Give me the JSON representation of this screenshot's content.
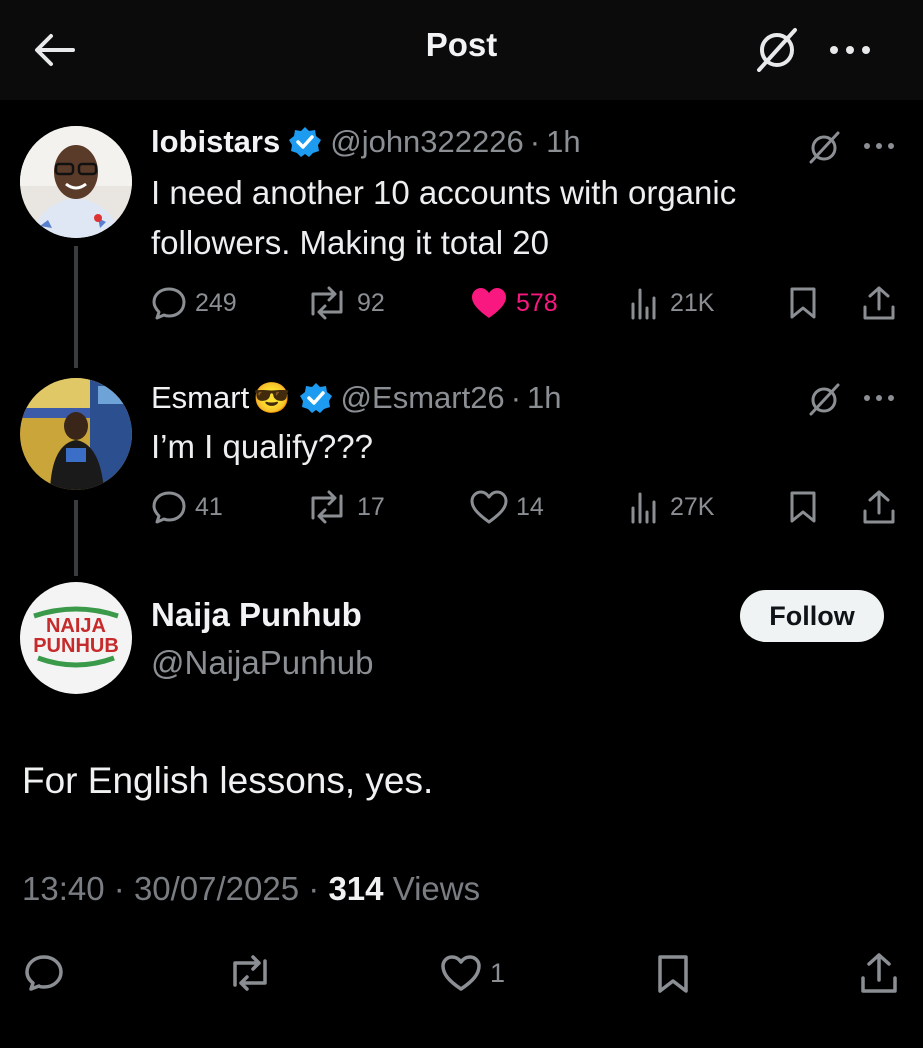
{
  "header": {
    "title": "Post"
  },
  "tweets": [
    {
      "name": "lobistars",
      "handle": "@john322226",
      "separator": "·",
      "time": "1h",
      "text_lines": [
        "I need another 10 accounts with organic",
        "followers. Making it total 20"
      ],
      "replies": "249",
      "reposts": "92",
      "likes": "578",
      "liked": true,
      "views": "21K"
    },
    {
      "name": "Esmart",
      "name_emoji": "😎",
      "handle": "@Esmart26",
      "separator": "·",
      "time": "1h",
      "text_lines": [
        "I’m I qualify???"
      ],
      "replies": "41",
      "reposts": "17",
      "likes": "14",
      "liked": false,
      "views": "27K"
    }
  ],
  "main_post": {
    "name": "Naija Punhub",
    "handle": "@NaijaPunhub",
    "follow_label": "Follow",
    "avatar_text_top": "NAIJA",
    "avatar_text_bottom": "PUNHUB",
    "text": "For English lessons, yes.",
    "time": "13:40",
    "date": "30/07/2025",
    "separator": "·",
    "views_count": "314",
    "views_label": "Views",
    "likes": "1"
  },
  "colors": {
    "background": "#000000",
    "like_pink": "#f91880",
    "verified_blue": "#1d9bf0",
    "muted": "#8b8f94"
  },
  "icons": [
    "back-arrow-icon",
    "grok-icon",
    "more-icon",
    "reply-icon",
    "repost-icon",
    "heart-icon",
    "views-icon",
    "bookmark-icon",
    "share-icon",
    "verified-icon"
  ]
}
